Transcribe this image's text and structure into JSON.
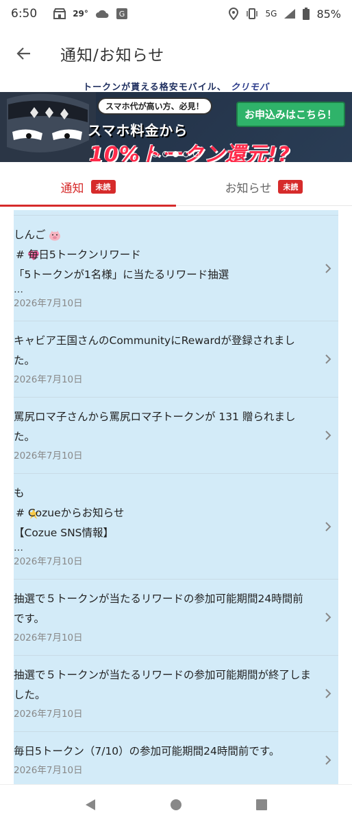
{
  "status_bar": {
    "time": "6:50",
    "temperature": "29°",
    "network": "5G",
    "battery": "85%"
  },
  "app_bar": {
    "title": "通知/お知らせ",
    "back_icon": "arrow-left-icon"
  },
  "banner": {
    "top_text": "トークンが貰える格安モバイル、",
    "brand": "クリモバ",
    "note": "スマホ代が高い方、必見！",
    "cta": "お申込みはこちら！",
    "line2": "スマホ料金から",
    "line3": "10%トークン還元!?",
    "slide_count": 5,
    "active_slide": 3
  },
  "tabs": [
    {
      "label": "通知",
      "badge": "未読",
      "active": true
    },
    {
      "label": "お知らせ",
      "badge": "未読",
      "active": false
    }
  ],
  "notifications": [
    {
      "lines": [
        "しんご",
        "# 毎日5トークンリワード",
        "「5トークンが1名様」に当たるリワード抽選"
      ],
      "ellipsis": "…",
      "date": "2026年7月10日"
    },
    {
      "lines": [
        "キャビア王国さんのCommunityにRewardが登録されました。"
      ],
      "date": "2026年7月10日"
    },
    {
      "lines": [
        "罵尻ロマ子さんから罵尻ロマ子トークンが 131 贈られました。"
      ],
      "date": "2026年7月10日"
    },
    {
      "lines": [
        "も",
        "# Cozueからお知らせ",
        "【Cozue SNS情報】"
      ],
      "ellipsis": "…",
      "date": "2026年7月10日"
    },
    {
      "lines": [
        "抽選で５トークンが当たるリワードの参加可能期間24時間前です。"
      ],
      "date": "2026年7月10日"
    },
    {
      "lines": [
        "抽選で５トークンが当たるリワードの参加可能期間が終了しました。"
      ],
      "date": "2026年7月10日"
    },
    {
      "lines": [
        "毎日5トークン（7/10）の参加可能期間24時間前です。"
      ],
      "date": "2026年7月10日"
    }
  ],
  "nav_bar": {
    "back": "triangle-back-icon",
    "home": "circle-home-icon",
    "recents": "square-recents-icon"
  },
  "colors": {
    "accent": "#d62b2b",
    "list_background": "#d3ebf8",
    "cta_green": "#2fb36a"
  }
}
